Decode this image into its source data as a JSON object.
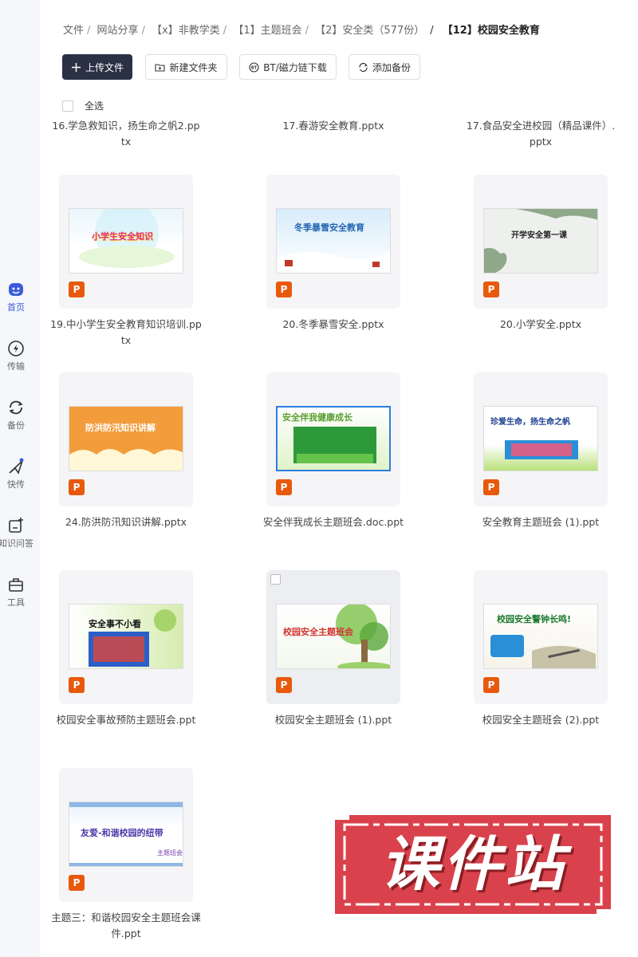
{
  "sidebar": {
    "items": [
      {
        "label": "首页",
        "icon": "home-icon"
      },
      {
        "label": "传输",
        "icon": "transfer-icon"
      },
      {
        "label": "备份",
        "icon": "backup-icon"
      },
      {
        "label": "快传",
        "icon": "quick-send-icon"
      },
      {
        "label": "知识问答",
        "icon": "qa-icon"
      },
      {
        "label": "工具",
        "icon": "toolbox-icon"
      }
    ]
  },
  "breadcrumb": [
    "文件",
    "网站分享",
    "【x】非教学类",
    "【1】主题班会",
    "【2】安全类（577份）"
  ],
  "breadcrumb_current": "【12】校园安全教育",
  "toolbar": {
    "upload": "上传文件",
    "new_folder": "新建文件夹",
    "bt": "BT/磁力链下载",
    "backup": "添加备份"
  },
  "select_all": "全选",
  "top_files": [
    {
      "name": "16.学急救知识，扬生命之帆2.pptx"
    },
    {
      "name": "17.春游安全教育.pptx"
    },
    {
      "name": "17.食品安全进校园（精品课件）.pptx"
    }
  ],
  "files": [
    {
      "name": "19.中小学生安全教育知识培训.pptx",
      "thumb_title": "小学生安全知识",
      "badge": "P"
    },
    {
      "name": "20.冬季暴雪安全.pptx",
      "thumb_title": "冬季暴雪安全教育",
      "badge": "P"
    },
    {
      "name": "20.小学安全.pptx",
      "thumb_title": "开学安全第一课",
      "badge": "P"
    },
    {
      "name": "24.防洪防汛知识讲解.pptx",
      "thumb_title": "防洪防汛知识讲解",
      "badge": "P"
    },
    {
      "name": "安全伴我成长主题班会.doc.ppt",
      "thumb_title": "安全伴我健康成长",
      "badge": "P"
    },
    {
      "name": "安全教育主题班会 (1).ppt",
      "thumb_title": "珍爱生命，扬生命之帆",
      "badge": "P"
    },
    {
      "name": "校园安全事故预防主题班会.ppt",
      "thumb_title": "安全事不小看",
      "badge": "P"
    },
    {
      "name": "校园安全主题班会 (1).ppt",
      "thumb_title": "校园安全主题班会",
      "badge": "P"
    },
    {
      "name": "校园安全主题班会 (2).ppt",
      "thumb_title": "校园安全警钟长鸣!",
      "badge": "P"
    },
    {
      "name": "主题三：和谐校园安全主题班会课件.ppt",
      "thumb_title": "友爱-和谐校园的纽带",
      "badge": "P"
    }
  ],
  "watermark_text": "课件站",
  "colors": {
    "accent": "#3b5bdb",
    "primary_button": "#2b3145",
    "ppt_badge": "#e8590c",
    "watermark": "#d9424c"
  }
}
